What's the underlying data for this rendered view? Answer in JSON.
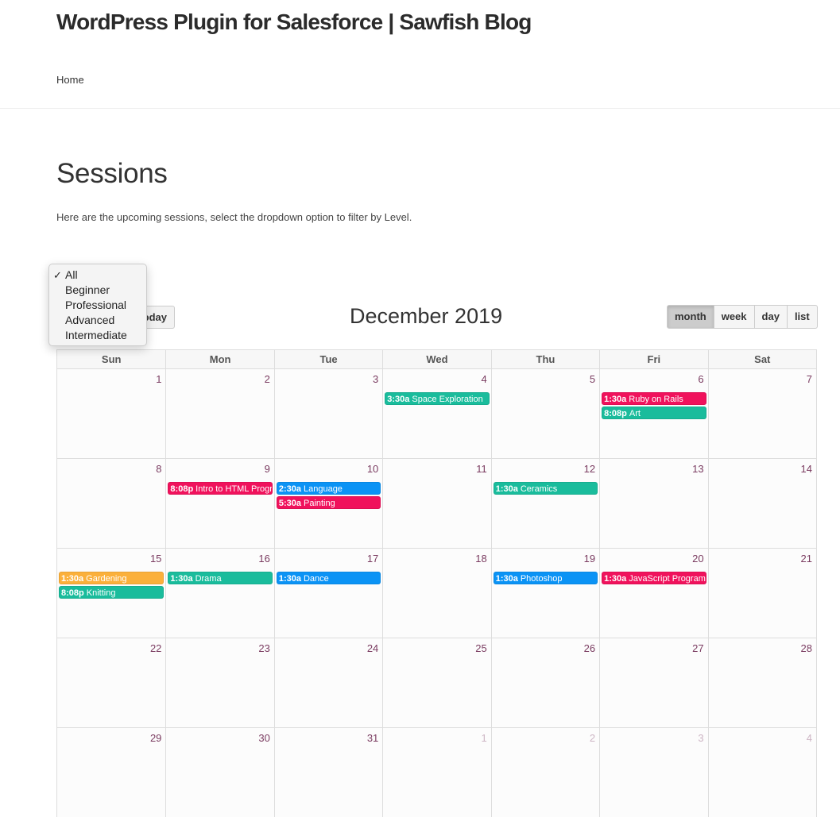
{
  "site": {
    "title": "WordPress Plugin for Salesforce | Sawfish Blog",
    "nav": [
      {
        "label": "Home"
      }
    ]
  },
  "page": {
    "title": "Sessions",
    "intro": "Here are the upcoming sessions, select the dropdown option to filter by Level."
  },
  "filter": {
    "selected": "All",
    "check_glyph": "✓",
    "options": [
      "All",
      "Beginner",
      "Professional",
      "Advanced",
      "Intermediate"
    ]
  },
  "toolbar": {
    "today_label": "today",
    "today_visible": "oday",
    "title": "December 2019",
    "views": [
      {
        "label": "month",
        "active": true
      },
      {
        "label": "week",
        "active": false
      },
      {
        "label": "day",
        "active": false
      },
      {
        "label": "list",
        "active": false
      }
    ]
  },
  "colors": {
    "green": "#1abc9c",
    "pink": "#f0125c",
    "blue": "#0b93f5",
    "orange": "#fbb03b",
    "day_number": "#7a3b60",
    "other_month": "#cdb5c4"
  },
  "calendar": {
    "day_headers": [
      "Sun",
      "Mon",
      "Tue",
      "Wed",
      "Thu",
      "Fri",
      "Sat"
    ],
    "weeks": [
      [
        {
          "day": "1"
        },
        {
          "day": "2"
        },
        {
          "day": "3"
        },
        {
          "day": "4",
          "events": [
            {
              "time": "3:30a",
              "title": "Space Exploration",
              "color": "green"
            }
          ]
        },
        {
          "day": "5"
        },
        {
          "day": "6",
          "events": [
            {
              "time": "1:30a",
              "title": "Ruby on Rails",
              "color": "pink"
            },
            {
              "time": "8:08p",
              "title": "Art",
              "color": "green"
            }
          ]
        },
        {
          "day": "7"
        }
      ],
      [
        {
          "day": "8"
        },
        {
          "day": "9",
          "events": [
            {
              "time": "8:08p",
              "title": "Intro to HTML Programming",
              "color": "pink"
            }
          ]
        },
        {
          "day": "10",
          "events": [
            {
              "time": "2:30a",
              "title": "Language",
              "color": "blue"
            },
            {
              "time": "5:30a",
              "title": "Painting",
              "color": "pink"
            }
          ]
        },
        {
          "day": "11"
        },
        {
          "day": "12",
          "events": [
            {
              "time": "1:30a",
              "title": "Ceramics",
              "color": "green"
            }
          ]
        },
        {
          "day": "13"
        },
        {
          "day": "14"
        }
      ],
      [
        {
          "day": "15",
          "events": [
            {
              "time": "1:30a",
              "title": "Gardening",
              "color": "orange"
            },
            {
              "time": "8:08p",
              "title": "Knitting",
              "color": "green"
            }
          ]
        },
        {
          "day": "16",
          "events": [
            {
              "time": "1:30a",
              "title": "Drama",
              "color": "green"
            }
          ]
        },
        {
          "day": "17",
          "events": [
            {
              "time": "1:30a",
              "title": "Dance",
              "color": "blue"
            }
          ]
        },
        {
          "day": "18"
        },
        {
          "day": "19",
          "events": [
            {
              "time": "1:30a",
              "title": "Photoshop",
              "color": "blue"
            }
          ]
        },
        {
          "day": "20",
          "events": [
            {
              "time": "1:30a",
              "title": "JavaScript Programming",
              "color": "pink"
            }
          ]
        },
        {
          "day": "21"
        }
      ],
      [
        {
          "day": "22"
        },
        {
          "day": "23"
        },
        {
          "day": "24"
        },
        {
          "day": "25"
        },
        {
          "day": "26"
        },
        {
          "day": "27"
        },
        {
          "day": "28"
        }
      ],
      [
        {
          "day": "29"
        },
        {
          "day": "30"
        },
        {
          "day": "31"
        },
        {
          "day": "1",
          "other_month": true
        },
        {
          "day": "2",
          "other_month": true
        },
        {
          "day": "3",
          "other_month": true
        },
        {
          "day": "4",
          "other_month": true
        }
      ]
    ]
  }
}
